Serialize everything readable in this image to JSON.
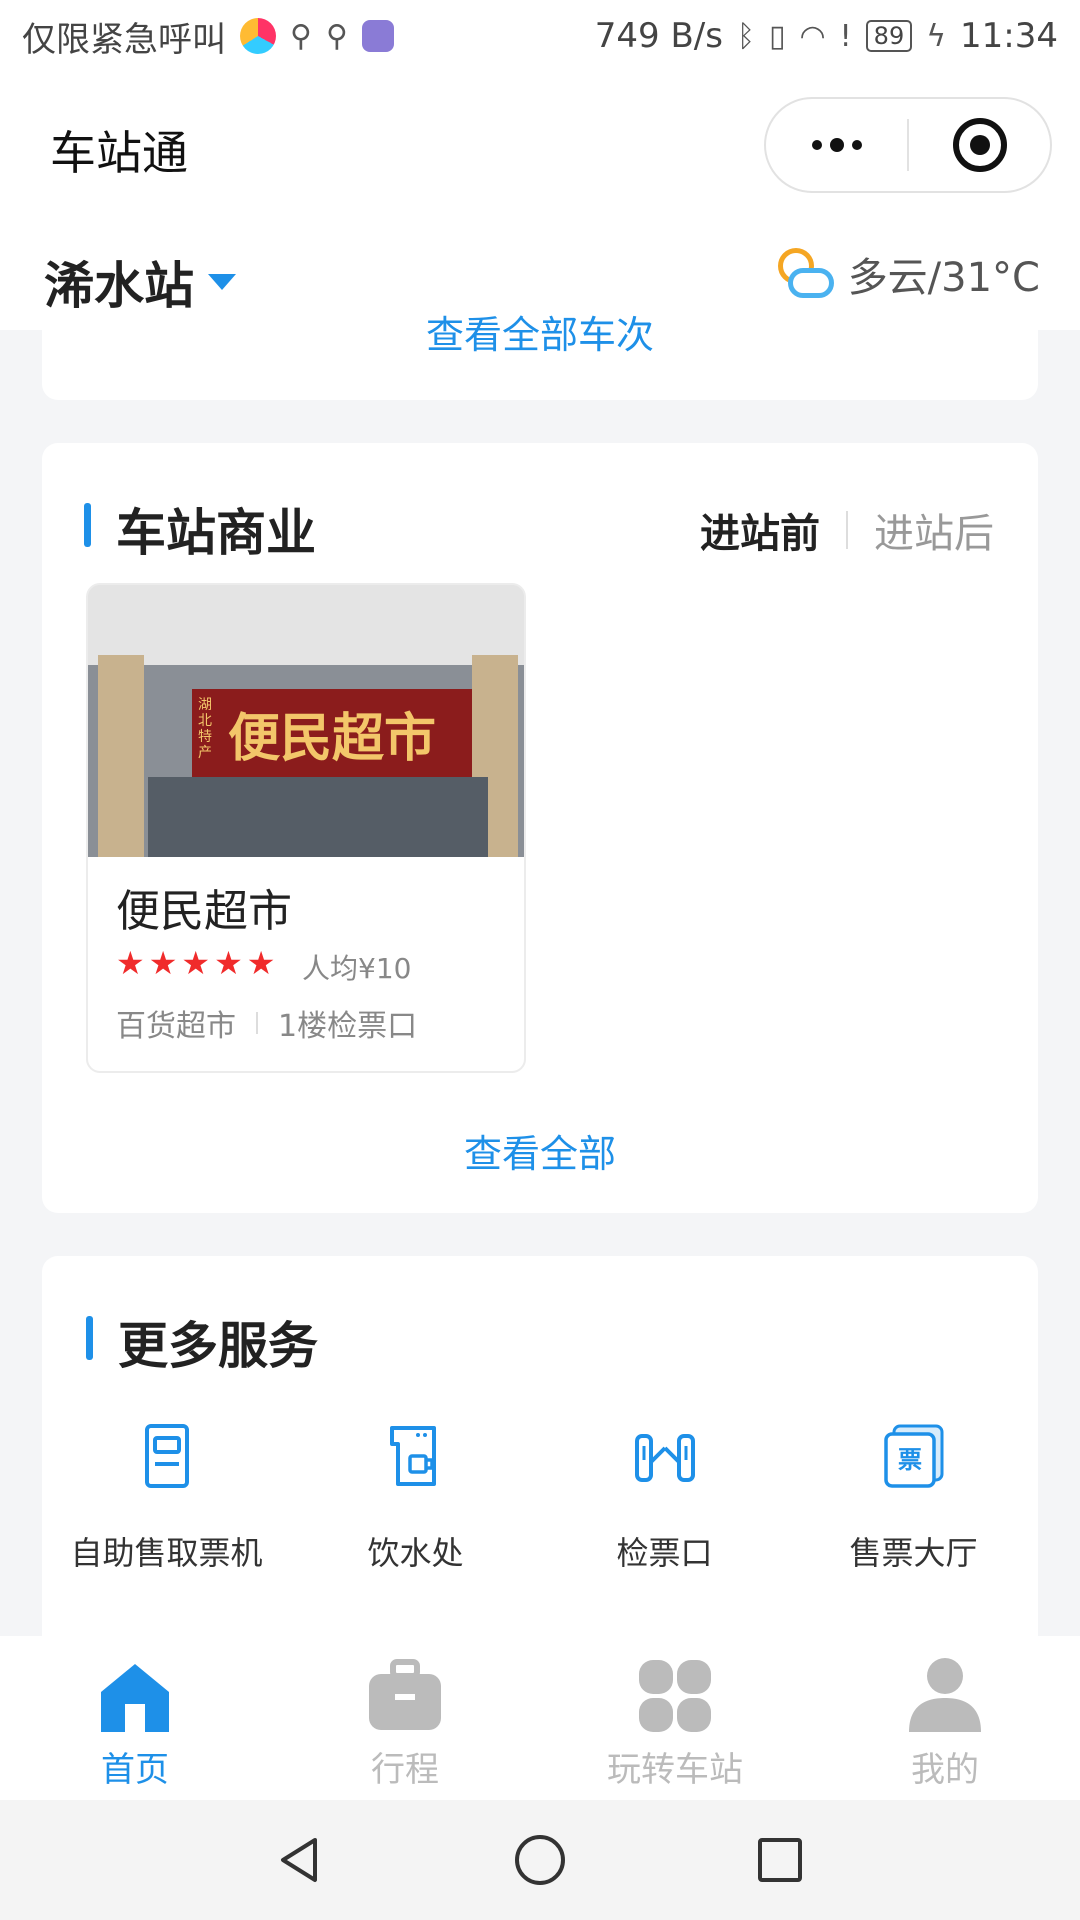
{
  "status_bar": {
    "carrier_text": "仅限紧急呼叫",
    "net_speed": "749 B/s",
    "battery": "89",
    "time": "11:34"
  },
  "header": {
    "app_title": "车站通"
  },
  "station": {
    "name": "浠水站",
    "weather": "多云/31°C"
  },
  "top_card": {
    "view_all_trains": "查看全部车次"
  },
  "business": {
    "title": "车站商业",
    "tabs": [
      "进站前",
      "进站后"
    ],
    "shop": {
      "sign_text": "便民超市",
      "sign_sub": "湖北特产",
      "name": "便民超市",
      "rating": 5,
      "avg_price": "人均¥10",
      "category": "百货超市",
      "location": "1楼检票口"
    },
    "view_all": "查看全部"
  },
  "services": {
    "title": "更多服务",
    "items": [
      {
        "label": "自助售取票机",
        "icon": "ticket-machine-icon"
      },
      {
        "label": "饮水处",
        "icon": "water-dispenser-icon"
      },
      {
        "label": "检票口",
        "icon": "ticket-gate-icon"
      },
      {
        "label": "售票大厅",
        "icon": "ticket-hall-icon",
        "glyph": "票"
      }
    ]
  },
  "tab_bar": {
    "items": [
      {
        "label": "首页",
        "icon": "home-icon",
        "active": true
      },
      {
        "label": "行程",
        "icon": "briefcase-icon",
        "active": false
      },
      {
        "label": "玩转车站",
        "icon": "grid-icon",
        "active": false
      },
      {
        "label": "我的",
        "icon": "profile-icon",
        "active": false
      }
    ]
  },
  "colors": {
    "accent": "#1e90e8",
    "star": "#f02b2b",
    "inactive": "#bbbbbb"
  }
}
